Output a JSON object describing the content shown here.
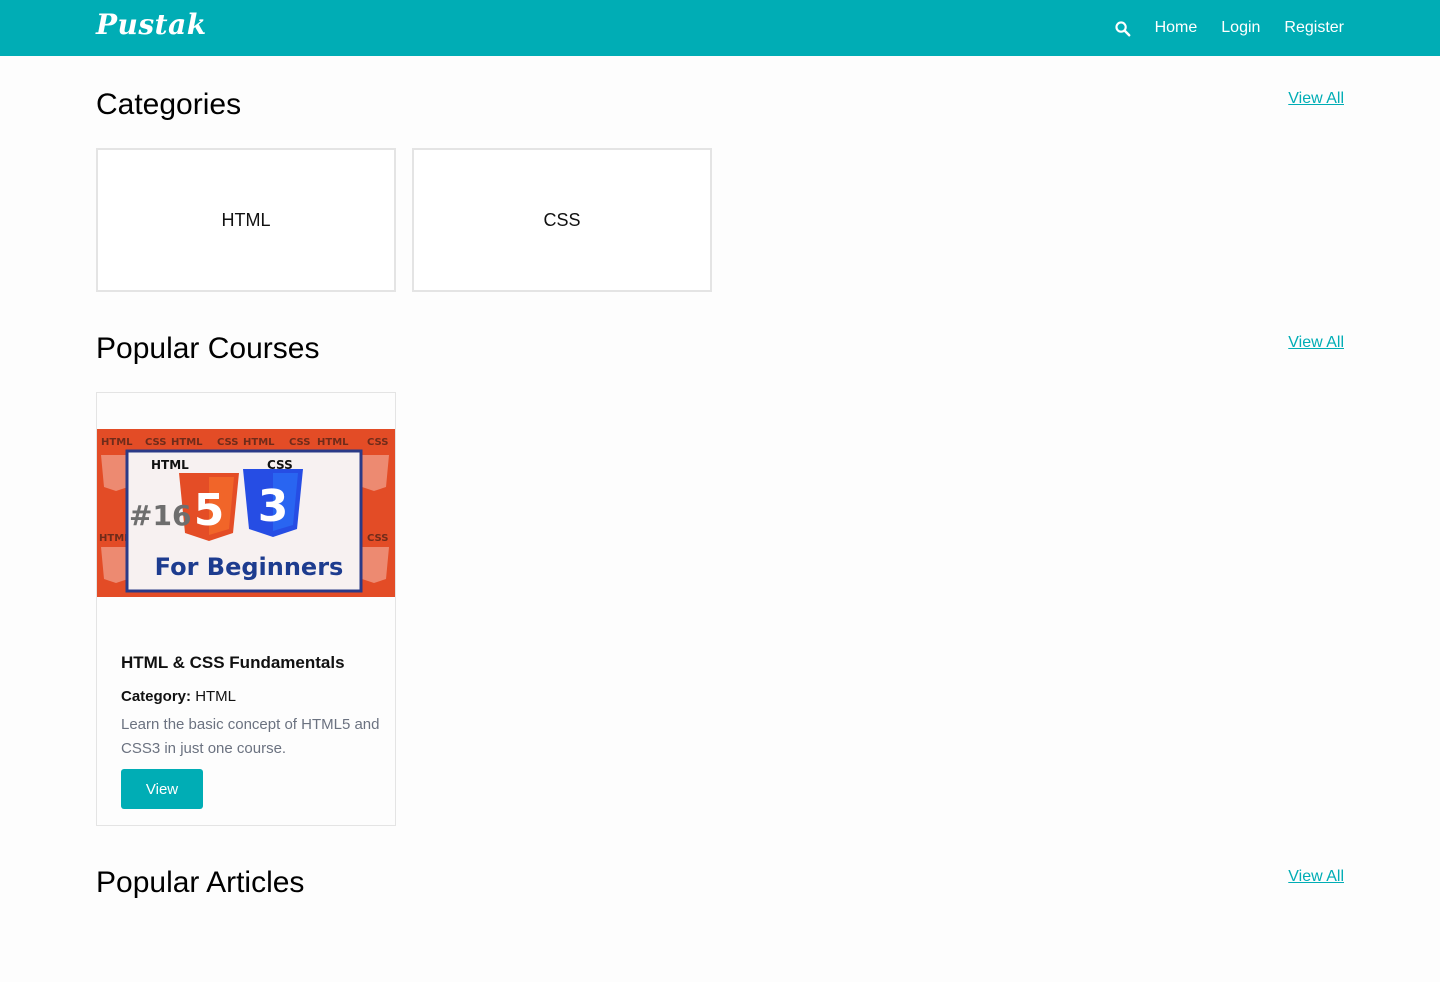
{
  "nav": {
    "brand": "Pustak",
    "links": [
      "Home",
      "Login",
      "Register"
    ]
  },
  "sections": {
    "categories": {
      "title": "Categories",
      "view_all": "View All"
    },
    "courses": {
      "title": "Popular Courses",
      "view_all": "View All"
    },
    "articles": {
      "title": "Popular Articles",
      "view_all": "View All"
    }
  },
  "categories": [
    "HTML",
    "CSS"
  ],
  "courses": [
    {
      "thumbnail_text": {
        "episode": "#16",
        "tagline": "For Beginners",
        "html_badge": "HTML",
        "css_badge": "CSS"
      },
      "title": "HTML & CSS Fundamentals",
      "category_label": "Category:",
      "category_value": "HTML",
      "description": "Learn the basic concept of HTML5 and CSS3 in just one course.",
      "button_label": "View"
    }
  ],
  "colors": {
    "accent": "#00adb5",
    "thumb_bg": "#e34c26",
    "html5": "#e44d26",
    "css3": "#264de4"
  },
  "icons": {
    "search": "search-icon"
  }
}
